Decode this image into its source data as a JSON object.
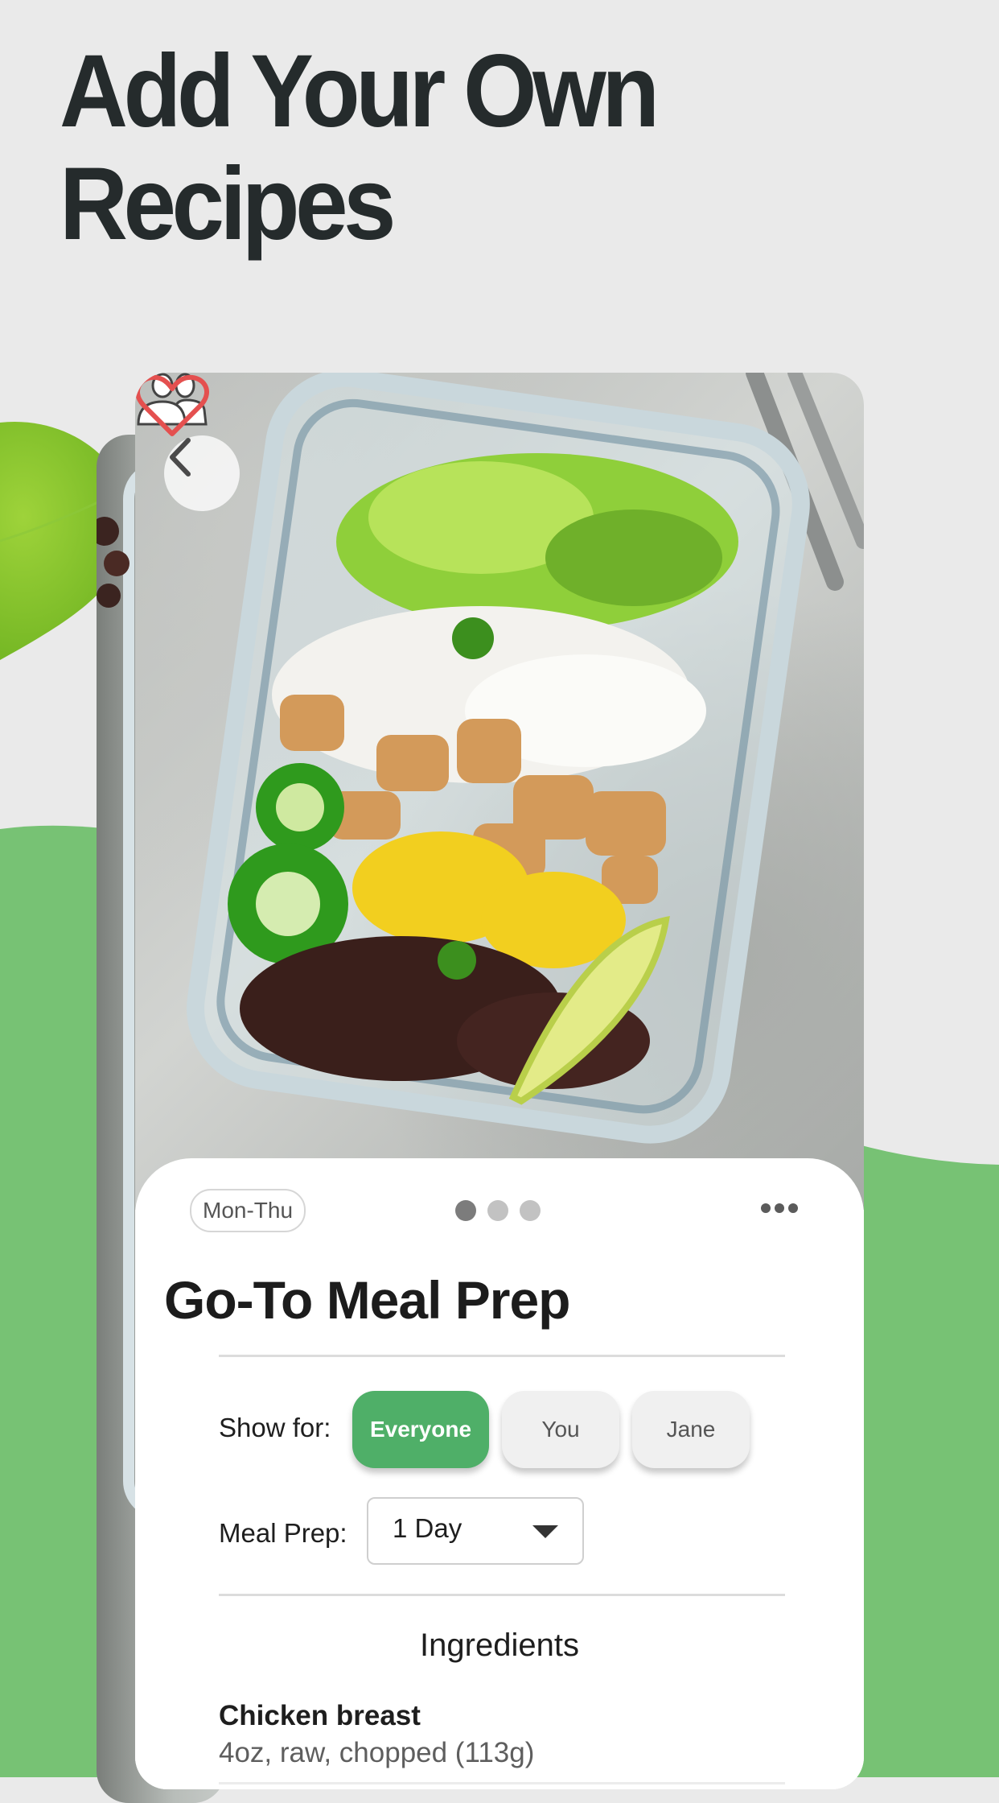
{
  "headline": {
    "line1": "Add Your Own",
    "line2": "Recipes"
  },
  "colors": {
    "background": "#eaeaea",
    "green_backdrop": "#77c274",
    "accent": "#4faf68",
    "heart": "#e4504f",
    "headline_text": "#252b2c"
  },
  "recipe_card": {
    "photo_alt": "Meal prep container with lettuce, rice, chicken, corn, jalapeño, black beans and lime",
    "icons": {
      "back": "chevron-left-icon",
      "share": "people-icon",
      "favorite": "heart-outline-icon",
      "more": "more-horizontal-icon"
    },
    "day_range": "Mon-Thu",
    "page_indicator": {
      "total": 3,
      "active": 1
    },
    "title": "Go-To Meal Prep",
    "show_for": {
      "label": "Show for:",
      "options": [
        "Everyone",
        "You",
        "Jane"
      ],
      "selected": "Everyone"
    },
    "meal_prep": {
      "label": "Meal Prep:",
      "value": "1 Day"
    },
    "ingredients_heading": "Ingredients",
    "ingredients": [
      {
        "name": "Chicken breast",
        "detail": "4oz, raw, chopped (113g)"
      }
    ]
  }
}
